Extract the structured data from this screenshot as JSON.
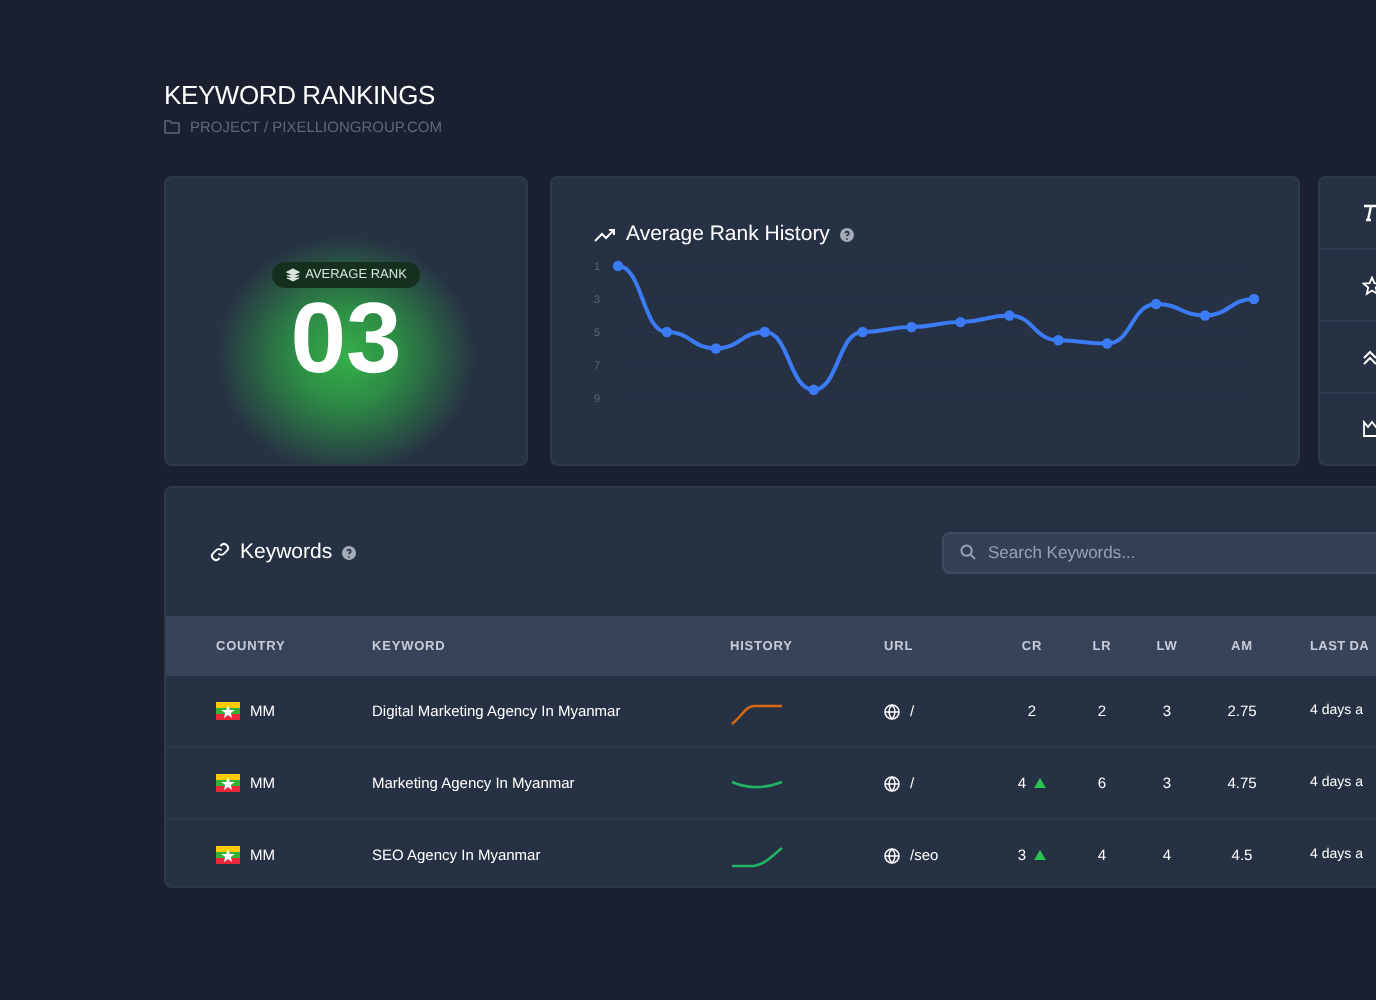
{
  "header": {
    "title": "KEYWORD RANKINGS",
    "breadcrumb": "PROJECT / PIXELLIONGROUP.COM"
  },
  "average_rank": {
    "badge": "AVERAGE RANK",
    "value": "03"
  },
  "rank_history": {
    "title": "Average Rank History",
    "chart_data": {
      "type": "line",
      "yticks": [
        1,
        3,
        5,
        7,
        9
      ],
      "ylim": [
        9,
        1
      ],
      "series": [
        {
          "color": "#3b7cf5",
          "marker": "circle",
          "values": [
            1,
            5,
            6,
            5,
            8.5,
            5,
            4.7,
            4.4,
            4,
            5.5,
            5.7,
            3.3,
            4,
            3
          ]
        }
      ]
    }
  },
  "keywords": {
    "title": "Keywords",
    "search": {
      "placeholder": "Search Keywords..."
    },
    "columns": [
      "COUNTRY",
      "KEYWORD",
      "HISTORY",
      "URL",
      "CR",
      "LR",
      "LW",
      "AM",
      "LAST DA"
    ],
    "rows": [
      {
        "country": "MM",
        "keyword": "Digital Marketing Agency In Myanmar",
        "color": "#d96a14",
        "url": "/",
        "cr": "2",
        "cr_up": false,
        "lr": "2",
        "lw": "3",
        "am": "2.75",
        "last": "4 days a"
      },
      {
        "country": "MM",
        "keyword": "Marketing Agency In Myanmar",
        "color": "#22b364",
        "url": "/",
        "cr": "4",
        "cr_up": true,
        "lr": "6",
        "lw": "3",
        "am": "4.75",
        "last": "4 days a"
      },
      {
        "country": "MM",
        "keyword": "SEO Agency In Myanmar",
        "color": "#22b364",
        "url": "/seo",
        "cr": "3",
        "cr_up": true,
        "lr": "4",
        "lw": "4",
        "am": "4.5",
        "last": "4 days a"
      }
    ]
  }
}
